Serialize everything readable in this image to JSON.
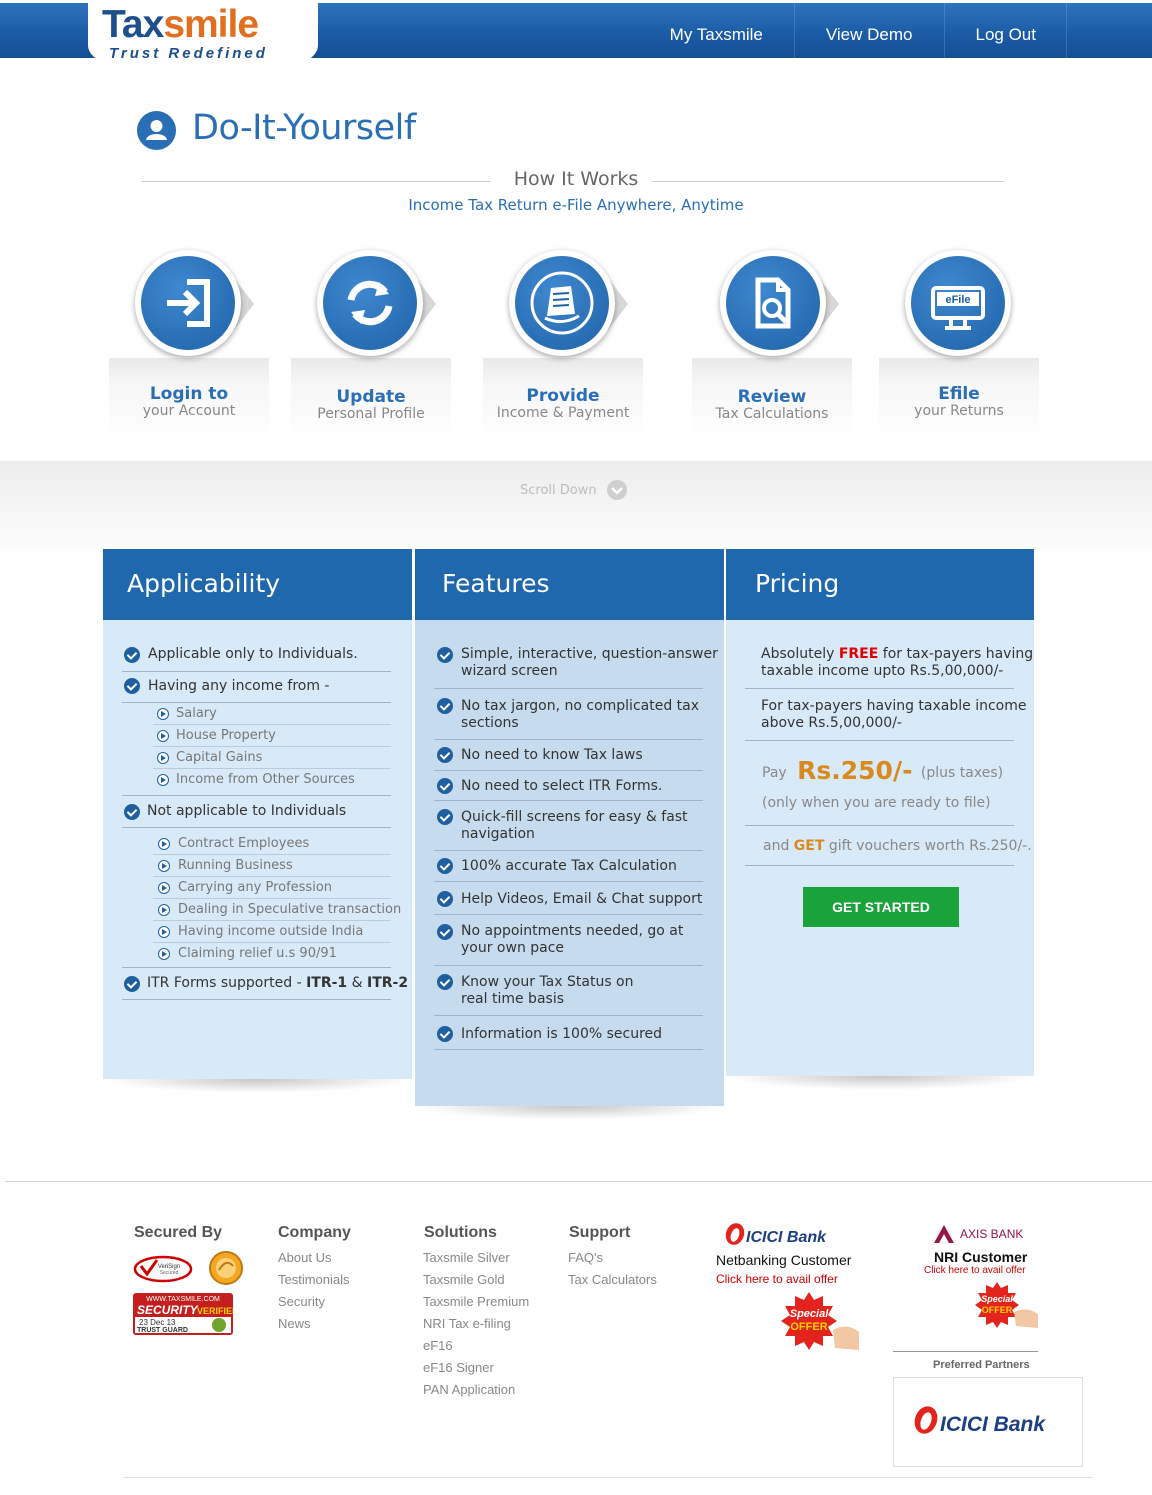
{
  "header": {
    "logo_main_a": "Tax",
    "logo_main_b": "smile",
    "logo_tagline": "Trust Redefined",
    "nav": [
      "My Taxsmile",
      "View Demo",
      "Log Out"
    ]
  },
  "page": {
    "title": "Do-It-Yourself",
    "how_title": "How It Works",
    "how_subtitle": "Income Tax Return e-File Anywhere, Anytime"
  },
  "steps": [
    {
      "label": "Login to",
      "sub": "your Account",
      "icon": "login-icon"
    },
    {
      "label": "Update",
      "sub": "Personal Profile",
      "icon": "refresh-icon"
    },
    {
      "label": "Provide",
      "sub": "Income & Payment",
      "icon": "documents-icon"
    },
    {
      "label": "Review",
      "sub": "Tax Calculations",
      "icon": "document-search-icon"
    },
    {
      "label": "Efile",
      "sub": "your Returns",
      "icon": "efile-monitor-icon"
    }
  ],
  "scroll_down": "Scroll Down",
  "applicability": {
    "title": "Applicability",
    "item1": "Applicable only to Individuals.",
    "item2": "Having any income from -",
    "income_sources": [
      "Salary",
      "House Property",
      "Capital Gains",
      "Income from Other Sources"
    ],
    "item3": "Not applicable to Individuals",
    "not_applicable": [
      "Contract Employees",
      "Running Business",
      "Carrying any Profession",
      "Dealing in Speculative transaction",
      "Having income outside India",
      "Claiming relief u.s 90/91"
    ],
    "item4_prefix": "ITR Forms supported - ",
    "item4_form1": "ITR-1",
    "item4_amp": " & ",
    "item4_form2": "ITR-2"
  },
  "features": {
    "title": "Features",
    "items": [
      [
        "Simple, interactive, question-answer",
        "wizard screen"
      ],
      [
        "No tax jargon, no complicated tax",
        "sections"
      ],
      [
        "No need to know Tax laws"
      ],
      [
        "No need to select ITR Forms."
      ],
      [
        "Quick-fill screens for easy & fast",
        "navigation"
      ],
      [
        "100% accurate Tax Calculation"
      ],
      [
        "Help Videos, Email & Chat support"
      ],
      [
        "No appointments needed, go at",
        "your own pace"
      ],
      [
        "Know your Tax Status on",
        "real time basis"
      ],
      [
        "Information is 100% secured"
      ]
    ]
  },
  "pricing": {
    "title": "Pricing",
    "p1_a": "Absolutely ",
    "p1_free": "FREE",
    "p1_b": " for tax-payers having",
    "p1_c": "taxable income upto Rs.5,00,000/-",
    "p2_a": "For tax-payers having taxable income",
    "p2_b": "above Rs.5,00,000/-",
    "pay": "Pay",
    "amount": "Rs.250/-",
    "plus_taxes": "(plus taxes)",
    "only_when": "(only when you are ready to file)",
    "and": "and ",
    "get": "GET",
    "gift": " gift vouchers worth Rs.250/-.",
    "cta": "GET STARTED"
  },
  "footer": {
    "secured_by": "Secured By",
    "company": {
      "title": "Company",
      "links": [
        "About Us",
        "Testimonials",
        "Security",
        "News"
      ]
    },
    "solutions": {
      "title": "Solutions",
      "links": [
        "Taxsmile Silver",
        "Taxsmile Gold",
        "Taxsmile Premium",
        "NRI Tax e-filing",
        "eF16",
        "eF16 Signer",
        "PAN Application"
      ]
    },
    "support": {
      "title": "Support",
      "links": [
        "FAQ's",
        "Tax Calculators"
      ]
    },
    "icici": {
      "bank": "ICICI Bank",
      "title": "Netbanking Customer",
      "link": "Click here to avail offer",
      "special": "Special",
      "offer": "OFFER"
    },
    "axis": {
      "bank": "AXIS BANK",
      "title": "NRI Customer",
      "link": "Click here to avail offer",
      "special": "Special",
      "offer": "OFFER"
    },
    "preferred_partners": "Preferred Partners",
    "partner_bank": "ICICI Bank",
    "verisign_a": "VeriSign",
    "verisign_b": "Secured",
    "trust_site": "WWW.TAXSMILE.COM",
    "trust_security": "SECURITY",
    "trust_verified": "VERIFIED",
    "trust_date": "23 Dec 13",
    "trust_guard": "TRUST GUARD"
  }
}
